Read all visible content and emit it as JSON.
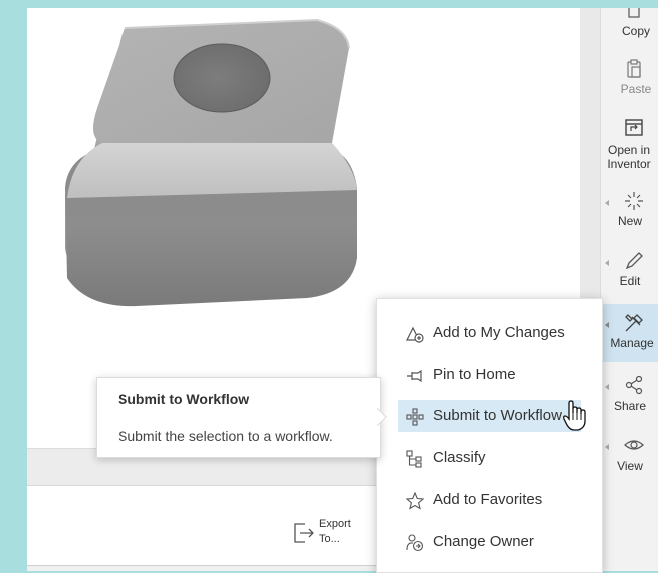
{
  "rail": {
    "items": [
      {
        "label": "Copy",
        "icon": "copy-icon"
      },
      {
        "label": "Paste",
        "icon": "paste-icon"
      },
      {
        "label": "Open in Inventor",
        "icon": "open-in-inventor-icon"
      },
      {
        "label": "New",
        "icon": "new-icon"
      },
      {
        "label": "Edit",
        "icon": "edit-icon"
      },
      {
        "label": "Manage",
        "icon": "manage-icon"
      },
      {
        "label": "Share",
        "icon": "share-icon"
      },
      {
        "label": "View",
        "icon": "view-icon"
      }
    ]
  },
  "menu": {
    "items": [
      {
        "label": "Add to My Changes",
        "icon": "add-to-changes-icon"
      },
      {
        "label": "Pin to Home",
        "icon": "pin-icon"
      },
      {
        "label": "Submit to Workflow",
        "icon": "workflow-icon"
      },
      {
        "label": "Classify",
        "icon": "classify-icon"
      },
      {
        "label": "Add to Favorites",
        "icon": "star-icon"
      },
      {
        "label": "Change Owner",
        "icon": "change-owner-icon"
      }
    ]
  },
  "tooltip": {
    "title": "Submit to Workflow",
    "description": "Submit the selection to a workflow."
  },
  "toolbar": {
    "export_label_1": "Export",
    "export_label_2": "To..."
  },
  "colors": {
    "accent": "#d7e9f5",
    "frame": "#a8dede",
    "model": "#9a9a9a"
  }
}
